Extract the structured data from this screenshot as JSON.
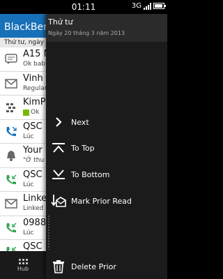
{
  "status_bar": {
    "time": "01:11",
    "network": "3G"
  },
  "hub": {
    "title": "BlackBerr",
    "date_header": "Thứ tư, ngày 20 tháng 3 n",
    "items": [
      {
        "sender": "A15 N",
        "snippet": "Ok baby",
        "icon": "sms-icon"
      },
      {
        "sender": "Vinh",
        "snippet": "Regular",
        "icon": "email-icon"
      },
      {
        "sender": "KimP",
        "snippet": "Ok",
        "icon": "bbm-icon"
      },
      {
        "sender": "QSC",
        "snippet": "Lúc",
        "icon": "phone-missed-icon"
      },
      {
        "sender": "Your",
        "snippet": "\"Ở thu",
        "icon": "bell-icon"
      },
      {
        "sender": "QSC",
        "snippet": "Lúc",
        "icon": "phone-incoming-icon"
      },
      {
        "sender": "Linke",
        "snippet": "Linked",
        "icon": "email-icon"
      },
      {
        "sender": "0988",
        "snippet": "Lúc",
        "icon": "phone-incoming-icon"
      },
      {
        "sender": "QSC",
        "snippet": "",
        "icon": "phone-incoming-icon"
      }
    ],
    "hub_button_label": "Hub"
  },
  "menu": {
    "title": "Thứ tư",
    "subtitle": "Ngày 20 tháng 3 năm 2013",
    "items": [
      {
        "label": "Next",
        "icon": "chevron-right-icon"
      },
      {
        "label": "To Top",
        "icon": "to-top-icon"
      },
      {
        "label": "To Bottom",
        "icon": "to-bottom-icon"
      },
      {
        "label": "Mark Prior Read",
        "icon": "mark-read-icon"
      },
      {
        "label": "Delete Prior",
        "icon": "trash-icon"
      }
    ]
  }
}
